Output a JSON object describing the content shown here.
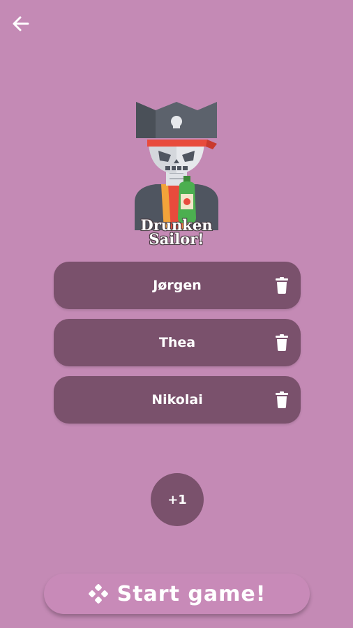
{
  "header": {
    "back_icon": "arrow-left-icon"
  },
  "logo": {
    "title": "Drunken\nSailor!"
  },
  "players": [
    {
      "name": "Jørgen",
      "delete_icon": "trash-icon"
    },
    {
      "name": "Thea",
      "delete_icon": "trash-icon"
    },
    {
      "name": "Nikolai",
      "delete_icon": "trash-icon"
    }
  ],
  "add_player": {
    "label": "+1"
  },
  "start": {
    "label": "Start game!",
    "icon": "gamepad-icon"
  },
  "colors": {
    "background": "#c48ab5",
    "card": "#7a516c",
    "text": "#ffffff"
  }
}
